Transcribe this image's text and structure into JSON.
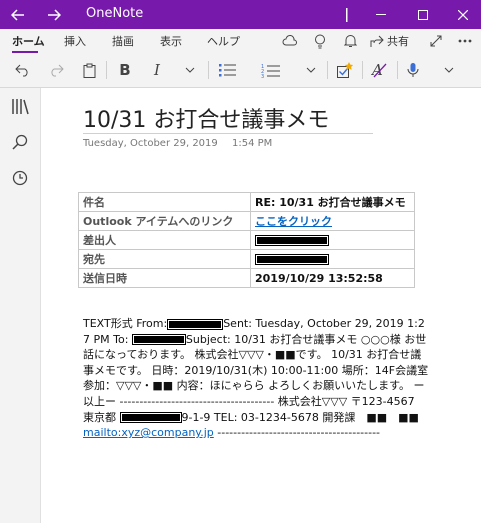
{
  "titlebar": {
    "app_title": "OneNote",
    "back_icon": "back-arrow-icon",
    "forward_icon": "forward-arrow-icon"
  },
  "ribbon": {
    "tabs": [
      "ホーム",
      "挿入",
      "描画",
      "表示",
      "ヘルプ"
    ],
    "active_tab": "ホーム",
    "share_label": "共有"
  },
  "page": {
    "title": "10/31 お打合せ議事メモ",
    "date": "Tuesday, October 29, 2019",
    "time": "1:54 PM"
  },
  "info_table": [
    {
      "key": "件名",
      "value": "RE: 10/31 お打合せ議事メモ"
    },
    {
      "key": "Outlook アイテムへのリンク",
      "value": "ここをクリック"
    },
    {
      "key": "差出人",
      "value": ""
    },
    {
      "key": "宛先",
      "value": ""
    },
    {
      "key": "送信日時",
      "value": "2019/10/29 13:52:58"
    }
  ],
  "body": {
    "p1": "TEXT形式 From:",
    "p2": "Sent: Tuesday, October 29, 2019 1:27 PM To:",
    "p3": "Subject: 10/31 お打合せ議事メモ ○○○様 お世話になっております。 株式会社▽▽▽・■■です。 10/31 お打合せ議事メモです。 日時：2019/10/31(木) 10:00-11:00 場所：14F会議室 参加：▽▽▽・■■ 内容：ほにゃらら よろしくお願いいたします。 ー以上ー --------------------------------------- 株式会社▽▽▽ 〒123-4567　東京都",
    "p4": "9-1-9 TEL: 03-1234-5678 開発課　■■　■■",
    "link": "mailto:xyz@company.jp",
    "tail": " -----------------------------------------"
  }
}
